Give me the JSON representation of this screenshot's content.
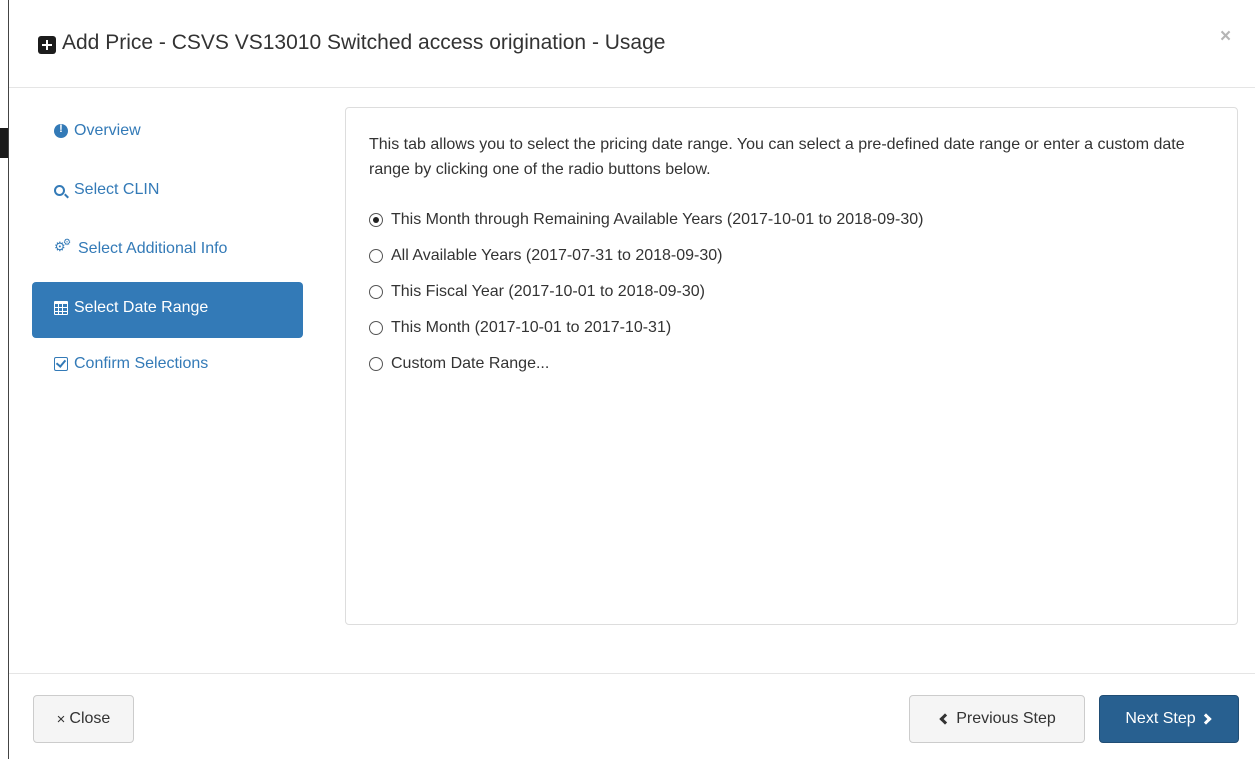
{
  "modal": {
    "title": "Add Price - CSVS VS13010 Switched access origination - Usage",
    "title_icon": "plus-square-icon",
    "close_glyph": "×"
  },
  "sidebar": {
    "items": [
      {
        "label": "Overview",
        "icon": "info-circle-icon",
        "active": false
      },
      {
        "label": "Select CLIN",
        "icon": "search-icon",
        "active": false
      },
      {
        "label": "Select Additional Info",
        "icon": "cogs-icon",
        "active": false
      },
      {
        "label": "Select Date Range",
        "icon": "calendar-icon",
        "active": true
      },
      {
        "label": "Confirm Selections",
        "icon": "check-square-icon",
        "active": false
      }
    ]
  },
  "content": {
    "description": "This tab allows you to select the pricing date range. You can select a pre-defined date range or enter a custom date range by clicking one of the radio buttons below.",
    "options": [
      {
        "label": "This Month through Remaining Available Years (2017-10-01 to 2018-09-30)",
        "checked": true
      },
      {
        "label": "All Available Years (2017-07-31 to 2018-09-30)",
        "checked": false
      },
      {
        "label": "This Fiscal Year (2017-10-01 to 2018-09-30)",
        "checked": false
      },
      {
        "label": "This Month (2017-10-01 to 2017-10-31)",
        "checked": false
      },
      {
        "label": "Custom Date Range...",
        "checked": false
      }
    ]
  },
  "footer": {
    "close_label": "Close",
    "close_glyph": "×",
    "previous_label": "Previous Step",
    "next_label": "Next Step"
  },
  "colors": {
    "primary": "#337ab7",
    "primary_dark": "#286090",
    "text": "#333333",
    "border": "#dddddd"
  }
}
